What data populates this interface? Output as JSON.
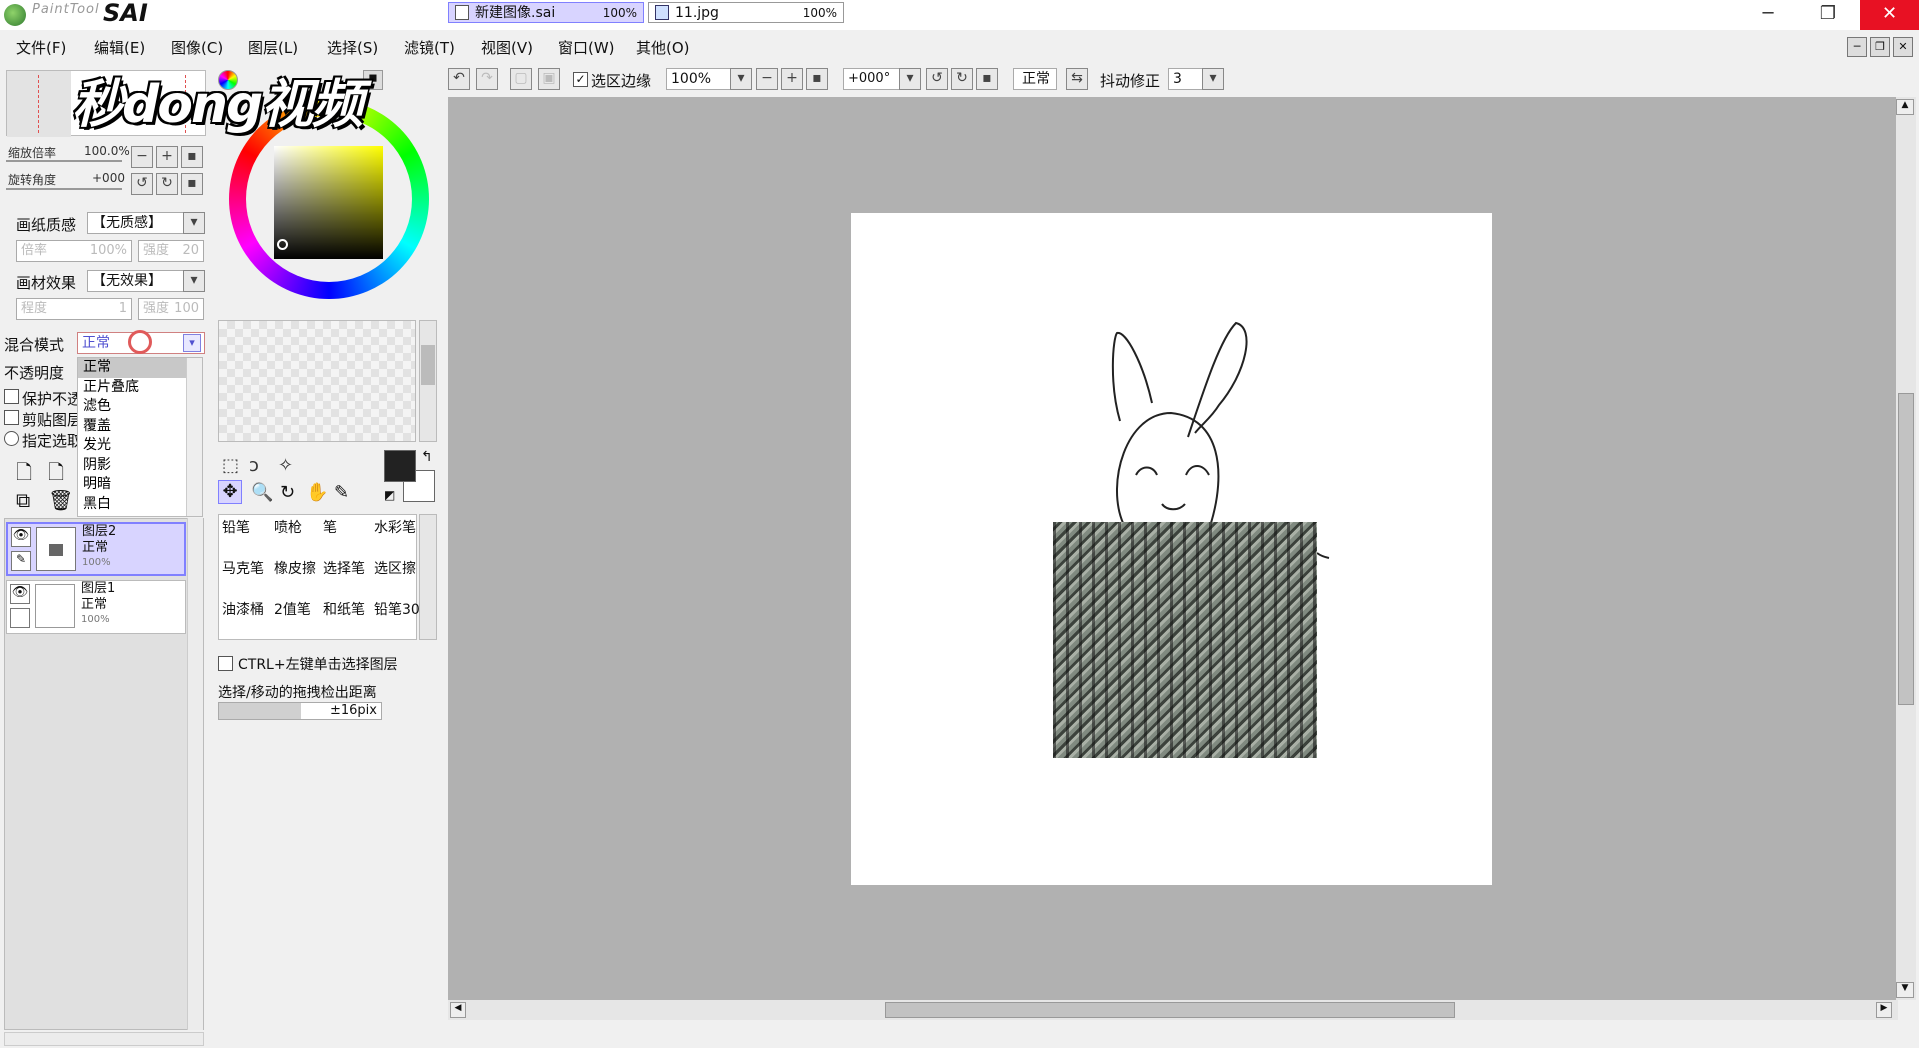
{
  "app": {
    "logo_text": "PaintTool",
    "logo_sai": "SAI"
  },
  "window_controls": {
    "minimize": "─",
    "restore": "❐",
    "close": "✕"
  },
  "menu": [
    "文件(F)",
    "编辑(E)",
    "图像(C)",
    "图层(L)",
    "选择(S)",
    "滤镜(T)",
    "视图(V)",
    "窗口(W)",
    "其他(O)"
  ],
  "navigator": {
    "zoom_label": "缩放倍率",
    "zoom_value": "100.0%",
    "rotate_label": "旋转角度",
    "rotate_value": "+000"
  },
  "paper": {
    "label": "画纸质感",
    "value": "【无质感】",
    "rate_label": "倍率",
    "rate_value": "100%",
    "strength_label": "强度",
    "strength_value": "20"
  },
  "material": {
    "label": "画材效果",
    "value": "【无效果】",
    "degree_label": "程度",
    "degree_value": "1",
    "strength_label": "强度",
    "strength_value": "100"
  },
  "blend": {
    "label": "混合模式",
    "value": "正常",
    "options": [
      "正常",
      "正片叠底",
      "滤色",
      "覆盖",
      "发光",
      "阴影",
      "明暗",
      "黑白"
    ],
    "selected_index": 0
  },
  "opacity_label": "不透明度",
  "checkboxes": {
    "protect": "保护不透",
    "clip": "剪贴图层",
    "select_source": "指定选取"
  },
  "layers": [
    {
      "name": "图层2",
      "mode": "正常",
      "opacity": "100%",
      "selected": true
    },
    {
      "name": "图层1",
      "mode": "正常",
      "opacity": "100%",
      "selected": false
    }
  ],
  "tools": [
    "铅笔",
    "喷枪",
    "笔",
    "水彩笔",
    "马克笔",
    "橡皮擦",
    "选择笔",
    "选区擦",
    "油漆桶",
    "2值笔",
    "和纸笔",
    "铅笔30"
  ],
  "options": {
    "ctrl_select": "CTRL+左键单击选择图层",
    "drag_distance_label": "选择/移动的拖拽检出距离",
    "drag_distance_value": "±16pix"
  },
  "toolbar": {
    "selection_edge": "选区边缘",
    "zoom": "100%",
    "rotation": "+000°",
    "mode": "正常",
    "stabilizer_label": "抖动修正",
    "stabilizer_value": "3"
  },
  "tabs": [
    {
      "name": "新建图像.sai",
      "zoom": "100%"
    },
    {
      "name": "11.jpg",
      "zoom": "100%"
    }
  ],
  "watermark": "秒dong视频",
  "colors": {
    "accent_selected": "#d8d4ff",
    "canvas_bg": "#b1b1b1",
    "close_red": "#e81123"
  }
}
